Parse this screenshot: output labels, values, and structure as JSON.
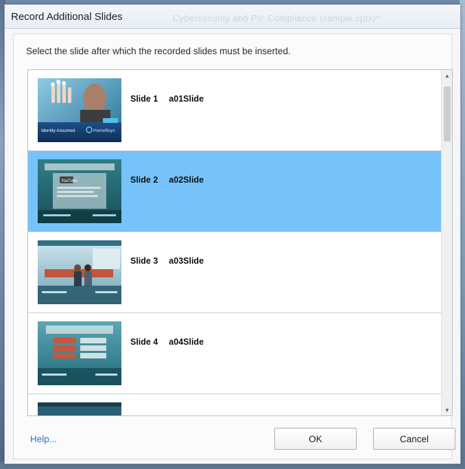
{
  "window": {
    "title": "Record Additional Slides",
    "background_title": "Cybersecurity and PII: Compliance (sample.cptx)*"
  },
  "dialog": {
    "instruction": "Select the slide after which the recorded slides must be inserted.",
    "selected_index": 1,
    "slides": [
      {
        "number": "Slide 1",
        "name": "a01Slide",
        "thumb_caption": "Identity Assumed",
        "thumb_brand": "HomeBuys"
      },
      {
        "number": "Slide 2",
        "name": "a02Slide",
        "thumb_caption": "YouTube"
      },
      {
        "number": "Slide 3",
        "name": "a03Slide"
      },
      {
        "number": "Slide 4",
        "name": "a04Slide"
      }
    ]
  },
  "footer": {
    "help_label": "Help...",
    "ok_label": "OK",
    "cancel_label": "Cancel"
  },
  "colors": {
    "selection": "#75c3fa",
    "link": "#2a78c6",
    "border": "#b9bfc7"
  },
  "icons": [
    "scroll-up-arrow-icon",
    "scroll-down-arrow-icon"
  ]
}
